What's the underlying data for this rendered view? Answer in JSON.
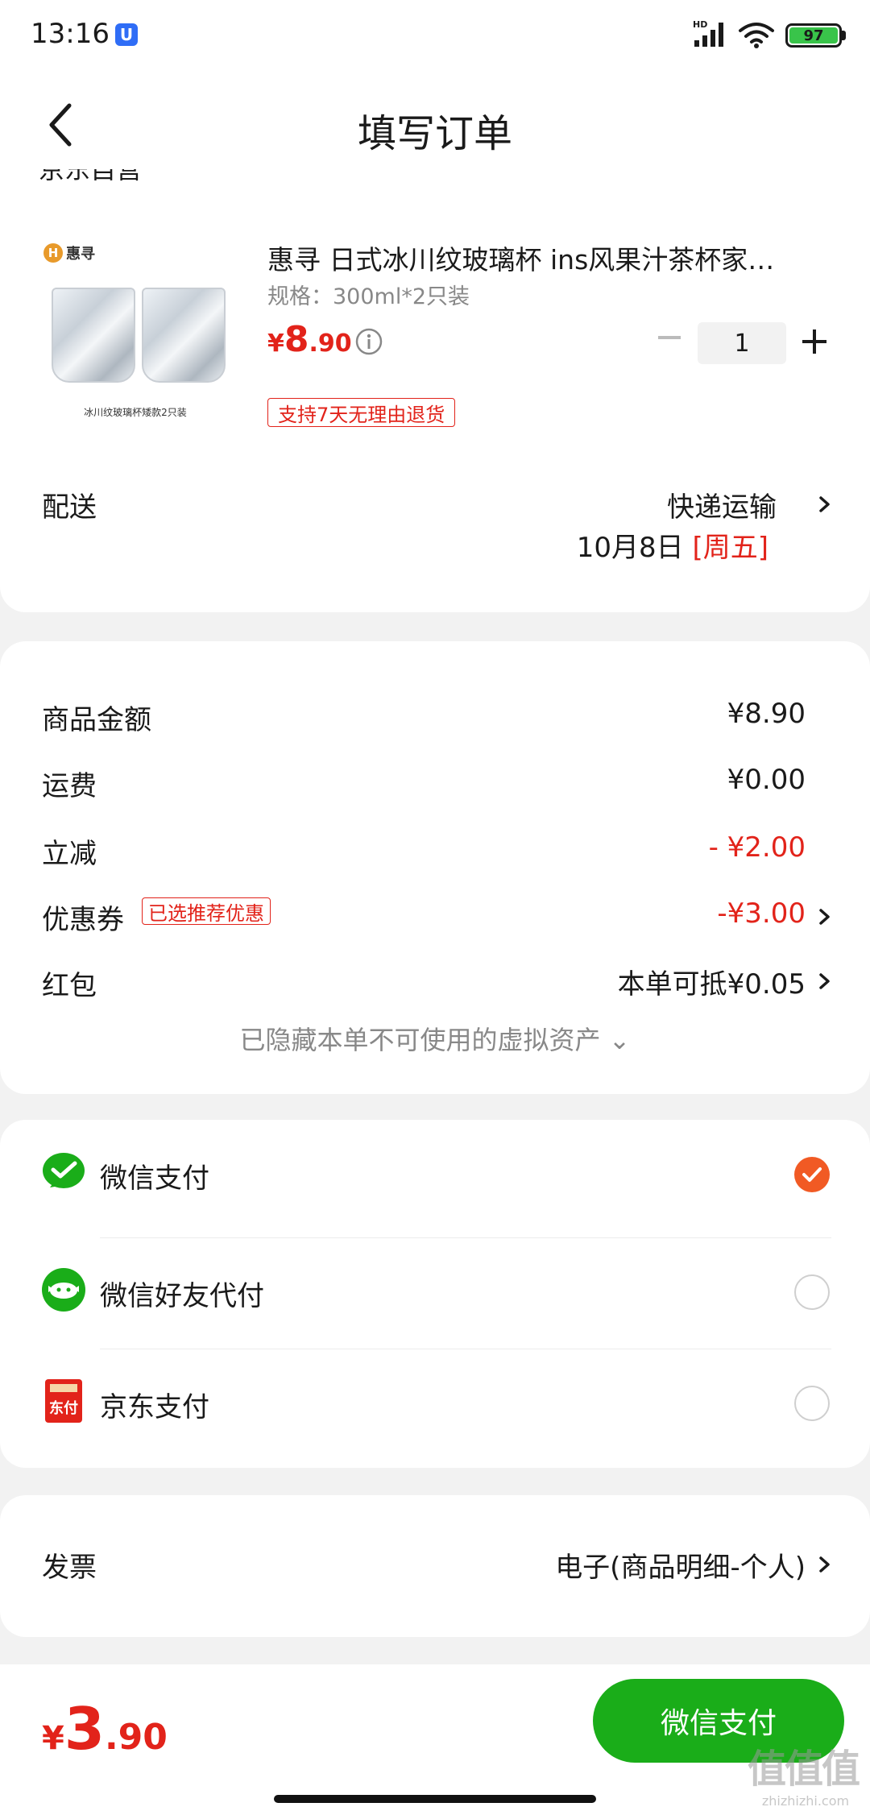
{
  "status_bar": {
    "time": "13:16",
    "app_badge": "U",
    "hd": "HD",
    "battery": "97"
  },
  "nav": {
    "title": "填写订单"
  },
  "shop": {
    "name": "京东自营"
  },
  "product": {
    "brand": "惠寻",
    "image_caption": "冰川纹玻璃杯矮款2只装",
    "title": "惠寻 日式冰川纹玻璃杯 ins风果汁茶杯家…",
    "spec": "规格：300ml*2只装",
    "price_symbol": "¥",
    "price_int": "8",
    "price_dec": ".90",
    "quantity": "1",
    "return_tag": "支持7天无理由退货"
  },
  "delivery": {
    "label": "配送",
    "method": "快递运输",
    "date": "10月8日",
    "day": "[周五]"
  },
  "summary": {
    "goods_label": "商品金额",
    "goods_value": "¥8.90",
    "shipping_label": "运费",
    "shipping_value": "¥0.00",
    "discount_label": "立减",
    "discount_value": "- ¥2.00",
    "coupon_label": "优惠券",
    "coupon_tag": "已选推荐优惠",
    "coupon_value": "-¥3.00",
    "redpacket_label": "红包",
    "redpacket_value": "本单可抵¥0.05",
    "hidden_assets": "已隐藏本单不可使用的虚拟资产 ⌄"
  },
  "payment": {
    "options": [
      {
        "label": "微信支付",
        "selected": true
      },
      {
        "label": "微信好友代付",
        "selected": false
      },
      {
        "label": "京东支付",
        "selected": false
      }
    ],
    "jd_icon_text": "东付"
  },
  "invoice": {
    "label": "发票",
    "value": "电子(商品明细-个人)"
  },
  "bottom": {
    "total_symbol": "¥",
    "total_int": "3",
    "total_dec": ".90",
    "pay_button": "微信支付"
  },
  "watermark": {
    "glyphs": "值值值",
    "site": "zhizhizhi.com"
  },
  "colors": {
    "accent_red": "#e2231a",
    "wechat_green": "#1aad19",
    "selected_orange": "#f15a24"
  }
}
